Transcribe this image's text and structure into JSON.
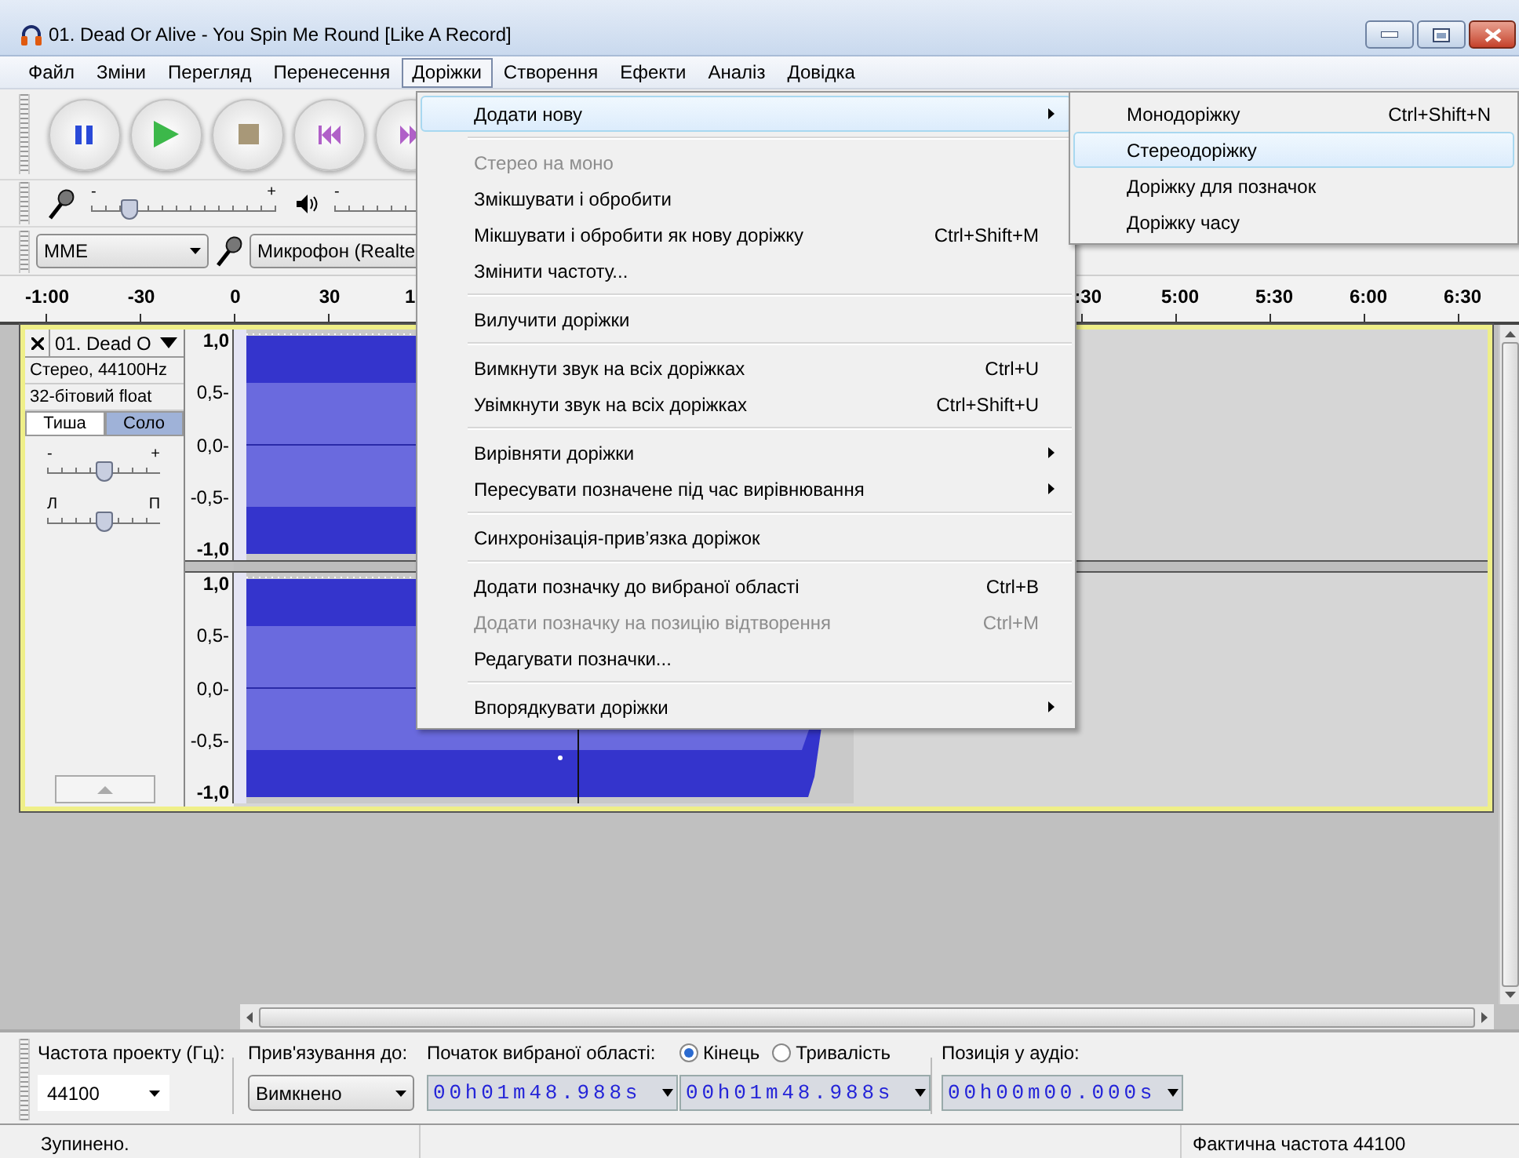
{
  "window": {
    "title": "01. Dead Or Alive - You Spin Me Round [Like A Record]"
  },
  "menubar": [
    {
      "label": "Файл",
      "selected": false
    },
    {
      "label": "Зміни",
      "selected": false
    },
    {
      "label": "Перегляд",
      "selected": false
    },
    {
      "label": "Перенесення",
      "selected": false
    },
    {
      "label": "Доріжки",
      "selected": true
    },
    {
      "label": "Створення",
      "selected": false
    },
    {
      "label": "Ефекти",
      "selected": false
    },
    {
      "label": "Аналіз",
      "selected": false
    },
    {
      "label": "Довідка",
      "selected": false
    }
  ],
  "meter_toolbar": {
    "input_slider": {
      "min_label": "-",
      "max_label": "+",
      "level": 0.2
    },
    "output_slider": {
      "min_label": "-"
    }
  },
  "device_toolbar": {
    "host": "MME",
    "input_device": "Микрофон (Realte"
  },
  "ruler": {
    "left_labels": [
      "-1:00",
      "-30",
      "0",
      "30",
      "1"
    ],
    "right_labels": [
      ":30",
      "5:00",
      "5:30",
      "6:00",
      "6:30"
    ]
  },
  "track": {
    "name": "01. Dead O",
    "info": [
      "Стерео, 44100Hz",
      "32-бітовий float"
    ],
    "mute": {
      "label": "Тиша",
      "selected": false
    },
    "solo": {
      "label": "Соло",
      "selected": true
    },
    "gain": {
      "min_label": "-",
      "max_label": "+",
      "level": 0.5
    },
    "pan": {
      "min_label": "Л",
      "max_label": "П",
      "level": 0.5
    },
    "channels": [
      {
        "scale": [
          "1,0",
          "0,5-",
          "0,0-",
          "-0,5-",
          "-1,0"
        ]
      },
      {
        "scale": [
          "1,0",
          "0,5-",
          "0,0-",
          "-0,5-",
          "-1,0"
        ]
      }
    ]
  },
  "menu": {
    "items": [
      {
        "kind": "item",
        "label": "Додати нову",
        "submenu": true,
        "disabled": false,
        "selected": true
      },
      {
        "kind": "separator"
      },
      {
        "kind": "item",
        "label": "Стерео на моно",
        "disabled": true,
        "selected": false
      },
      {
        "kind": "item",
        "label": "Змікшувати і обробити",
        "disabled": false,
        "selected": false
      },
      {
        "kind": "item",
        "label": "Мікшувати і обробити як нову доріжку",
        "shortcut": "Ctrl+Shift+M",
        "disabled": false,
        "selected": false
      },
      {
        "kind": "item",
        "label": "Змінити частоту...",
        "disabled": false,
        "selected": false
      },
      {
        "kind": "separator"
      },
      {
        "kind": "item",
        "label": "Вилучити доріжки",
        "disabled": false,
        "selected": false
      },
      {
        "kind": "separator"
      },
      {
        "kind": "item",
        "label": "Вимкнути звук на всіх доріжках",
        "shortcut": "Ctrl+U",
        "disabled": false,
        "selected": false
      },
      {
        "kind": "item",
        "label": "Увімкнути звук на всіх доріжках",
        "shortcut": "Ctrl+Shift+U",
        "disabled": false,
        "selected": false
      },
      {
        "kind": "separator"
      },
      {
        "kind": "item",
        "label": "Вирівняти доріжки",
        "submenu": true,
        "disabled": false,
        "selected": false
      },
      {
        "kind": "item",
        "label": "Пересувати позначене під час вирівнювання",
        "submenu": true,
        "disabled": false,
        "selected": false
      },
      {
        "kind": "separator"
      },
      {
        "kind": "item",
        "label": "Синхронізація-прив’язка доріжок",
        "disabled": false,
        "selected": false
      },
      {
        "kind": "separator"
      },
      {
        "kind": "item",
        "label": "Додати позначку до вибраної області",
        "shortcut": "Ctrl+B",
        "disabled": false,
        "selected": false
      },
      {
        "kind": "item",
        "label": "Додати позначку на позицію відтворення",
        "shortcut": "Ctrl+M",
        "disabled": true,
        "selected": false
      },
      {
        "kind": "item",
        "label": "Редагувати позначки...",
        "disabled": false,
        "selected": false
      },
      {
        "kind": "separator"
      },
      {
        "kind": "item",
        "label": "Впорядкувати доріжки",
        "submenu": true,
        "disabled": false,
        "selected": false
      }
    ]
  },
  "submenu": {
    "items": [
      {
        "label": "Монодоріжку",
        "shortcut": "Ctrl+Shift+N",
        "selected": false
      },
      {
        "label": "Стереодоріжку",
        "selected": true
      },
      {
        "label": "Доріжку для позначок",
        "selected": false
      },
      {
        "label": "Доріжку часу",
        "selected": false
      }
    ]
  },
  "selection_toolbar": {
    "rate_label": "Частота проекту (Гц):",
    "rate": "44100",
    "snap_label": "Прив'язування до:",
    "snap": "Вимкнено",
    "start_label": "Початок вибраної області:",
    "start": "00h01m48.988s",
    "end_radio": {
      "label": "Кінець",
      "selected": true
    },
    "length_radio": {
      "label": "Тривалість",
      "selected": false
    },
    "end": "00h01m48.988s",
    "position_label": "Позиція у аудіо:",
    "position": "00h00m00.000s"
  },
  "status_bar": {
    "state": "Зупинено.",
    "rate": "Фактична частота 44100"
  }
}
